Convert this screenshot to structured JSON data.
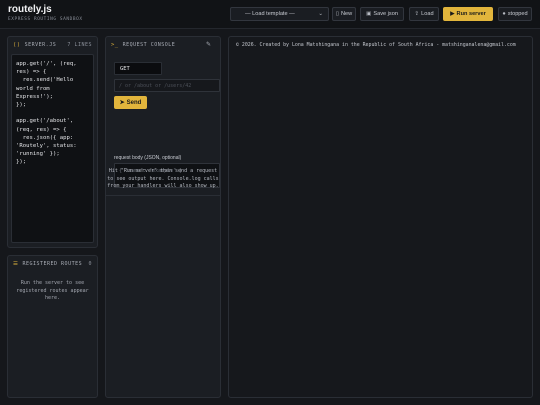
{
  "header": {
    "title": "routely.js",
    "tagline": "EXPRESS ROUTING SANDBOX",
    "template_select": "— Load template —",
    "new_label": "New",
    "save_label": "Save json",
    "load_label": "Load",
    "run_label": "Run server",
    "status_label": "stopped"
  },
  "server_panel": {
    "title": "SERVER.JS",
    "line_count": "7 LINES",
    "code": "app.get('/', (req,\nres) => {\n  res.send('Hello\nworld from Express!');\n});\n\napp.get('/about',\n(req, res) => {\n  res.json({ app:\n'Routely', status:\n'running' });\n});"
  },
  "routes_panel": {
    "title": "REGISTERED ROUTES",
    "count": "0",
    "hint": "Run the server to see registered routes appear here."
  },
  "request_console": {
    "title": "REQUEST CONSOLE",
    "method": "GET",
    "url_placeholder": "/ or /about or /users/42",
    "send_label": "Send",
    "body_label": "request body (JSON, optional)",
    "body_placeholder": "{ \"name\": \"example\" }",
    "message": "Hit \"Run server\" then send a request to see output here. Console.log calls from your handlers will also show up."
  },
  "output_panel": {
    "copyright": "© 2026. Created by Lona Matshingana in the Republic of South Africa - matshinganalena@gmail.com"
  },
  "colors": {
    "accent": "#e2b53c",
    "background": "#15171b",
    "panel": "#1b1e23"
  }
}
